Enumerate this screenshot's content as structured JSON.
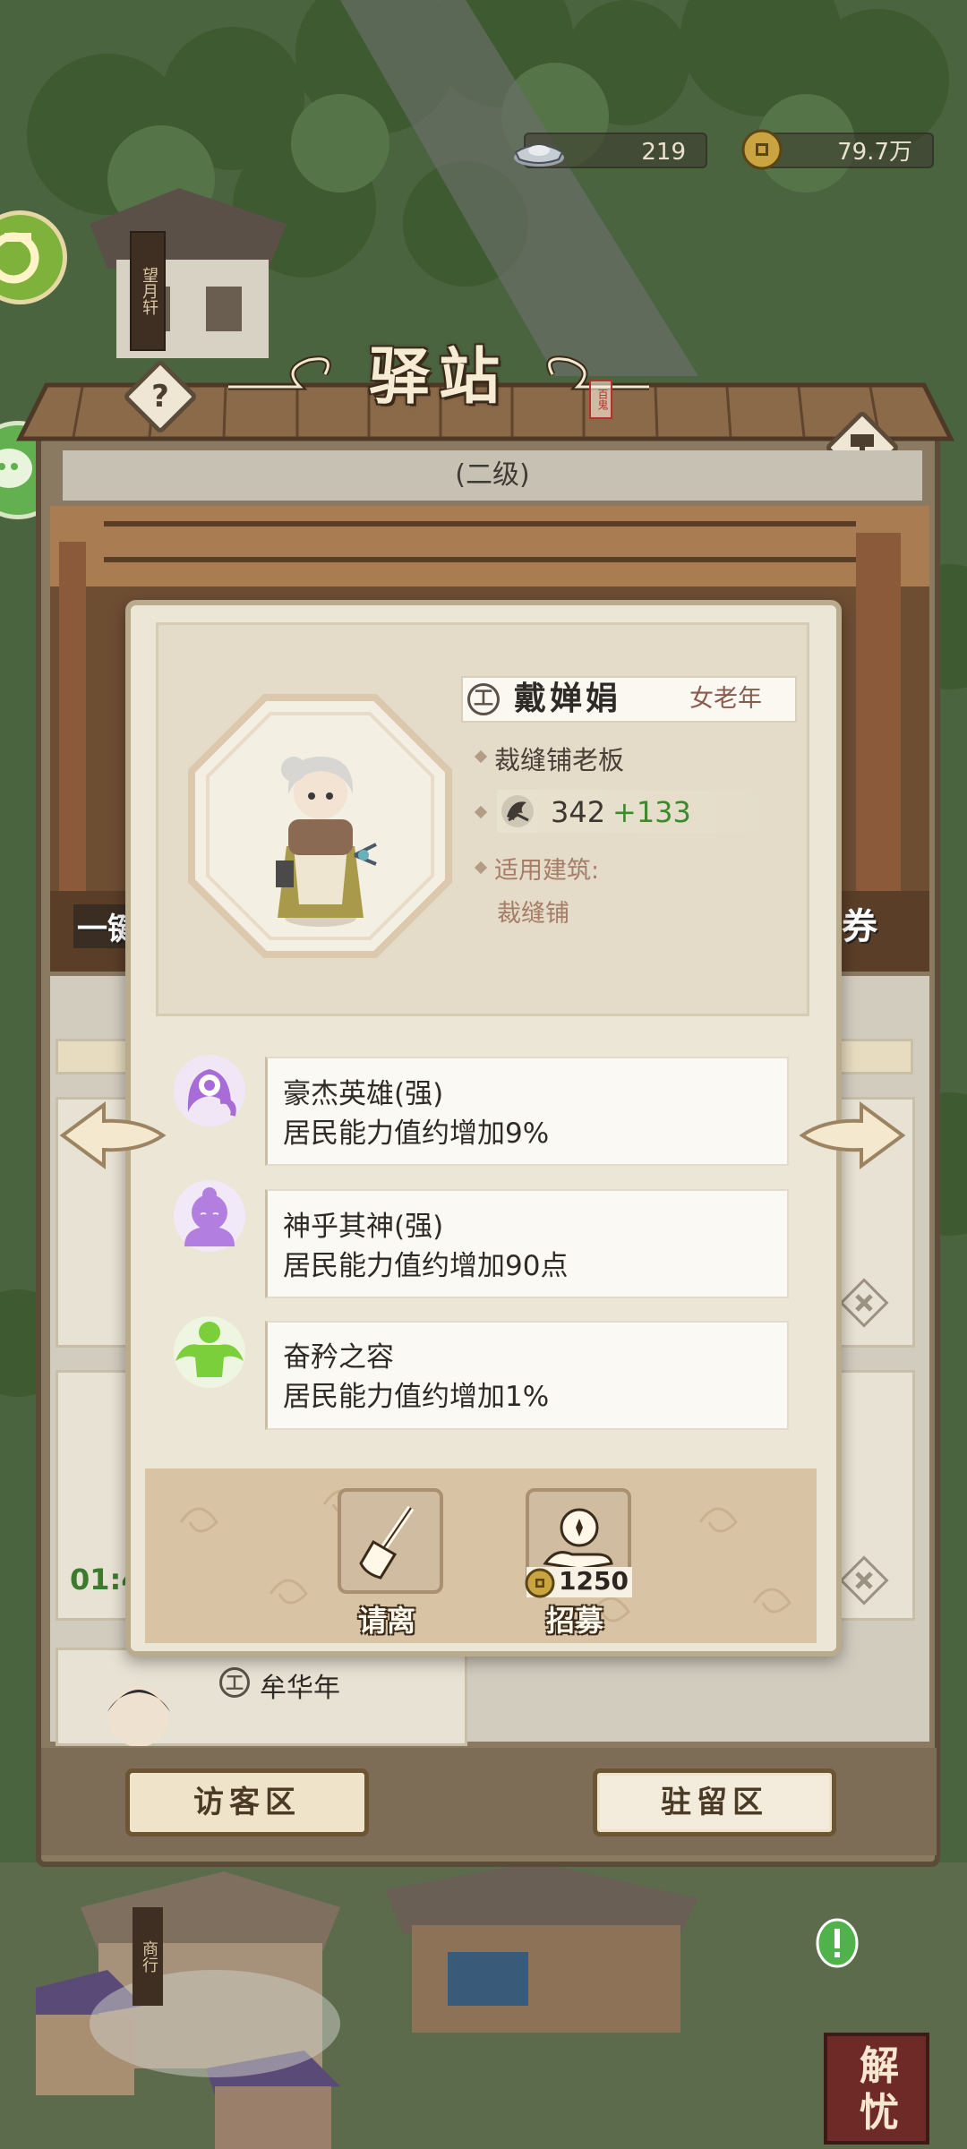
{
  "top_bar": {
    "silver": "219",
    "copper": "79.7万"
  },
  "building": {
    "title": "驿站",
    "seal": "百鬼",
    "level": "(二级)",
    "help_icon": "question-icon",
    "upgrade_icon": "hammer-icon",
    "roof_sign_left": "望月轩",
    "left_partial_text": "一键",
    "right_partial_text": "券"
  },
  "character": {
    "job_icon": "工",
    "name": "戴婵娟",
    "meta": "女老年",
    "title": "裁缝铺老板",
    "power_base": "342",
    "power_bonus": "+133",
    "building_label": "适用建筑:",
    "building_value": "裁缝铺"
  },
  "traits": [
    {
      "name": "豪杰英雄(强)",
      "desc": "居民能力值约增加9%",
      "icon": "hero-icon",
      "color": "#a86cd8"
    },
    {
      "name": "神乎其神(强)",
      "desc": "居民能力值约增加90点",
      "icon": "buddha-icon",
      "color": "#b27fe0"
    },
    {
      "name": "奋矜之容",
      "desc": "居民能力值约增加1%",
      "icon": "strongman-icon",
      "color": "#7bcf3a"
    }
  ],
  "actions": {
    "dismiss_label": "请离",
    "recruit_label": "招募",
    "recruit_cost": "1250"
  },
  "background_list": {
    "timer_partial": "01:4",
    "row_job_icon": "工",
    "row_name": "牟华年"
  },
  "footer": {
    "visitor_tab": "访客区",
    "resident_tab": "驻留区"
  },
  "bottom_right": {
    "label": "解忧",
    "shop_sign": "商行"
  },
  "colors": {
    "panel_frame": "#5b4b39",
    "card_bg": "#ece6d6",
    "bonus_green": "#3c8a2e",
    "meta_red": "#8a5a4e"
  }
}
